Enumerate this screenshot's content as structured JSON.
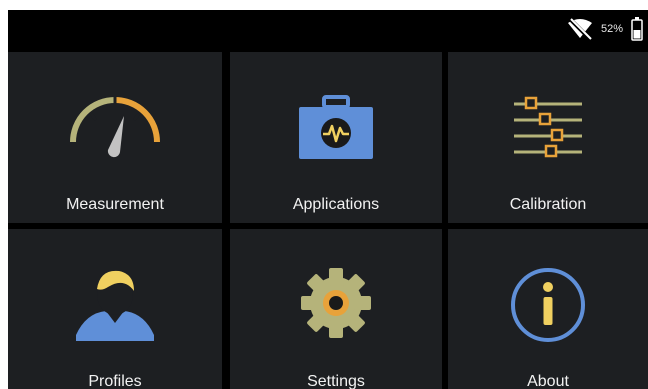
{
  "status_bar": {
    "battery_percent": "52%",
    "wifi_icon": "wifi-off-icon",
    "battery_icon": "battery-icon"
  },
  "menu": {
    "items": [
      {
        "label": "Measurement",
        "icon": "gauge-icon"
      },
      {
        "label": "Applications",
        "icon": "toolbox-icon"
      },
      {
        "label": "Calibration",
        "icon": "sliders-icon"
      },
      {
        "label": "Profiles",
        "icon": "user-icon"
      },
      {
        "label": "Settings",
        "icon": "gear-icon"
      },
      {
        "label": "About",
        "icon": "info-icon"
      }
    ]
  },
  "colors": {
    "background": "#000000",
    "tile": "#1d1f22",
    "label": "#f2f2f2",
    "accent_yellow": "#f0d060",
    "accent_orange": "#e8a23a",
    "accent_olive": "#b5b37a",
    "accent_blue": "#5f8fd8",
    "accent_gray": "#c2c2c2"
  }
}
